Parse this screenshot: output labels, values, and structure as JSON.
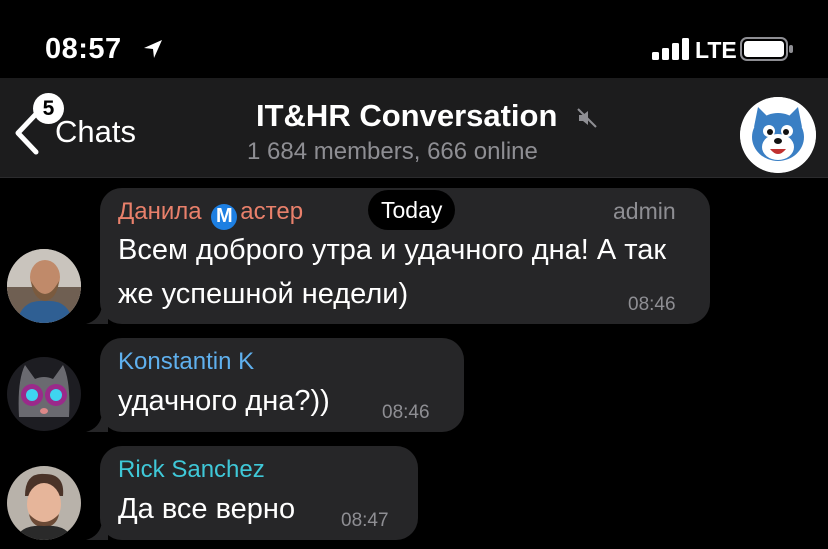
{
  "status_bar": {
    "time": "08:57",
    "network": "LTE"
  },
  "header": {
    "back_badge": "5",
    "back_label": "Chats",
    "title": "IT&HR Conversation",
    "subtitle": "1 684 members, 666 online",
    "icons": {
      "back": "chevron-left-icon",
      "mute": "muted-speaker-icon",
      "location": "location-arrow-icon"
    }
  },
  "date_pill": "Today",
  "messages": [
    {
      "sender_before": "Данила",
      "sender_badge": "M",
      "sender_after": "астер",
      "sender_color": "#e9806b",
      "role": "admin",
      "text": "Всем доброго утра и удачного дна! А так же успешной недели)",
      "time": "08:46"
    },
    {
      "sender": "Konstantin K",
      "sender_color": "#5fb0ee",
      "text": "удачного дна?))",
      "time": "08:46"
    },
    {
      "sender": "Rick Sanchez",
      "sender_color": "#3fc8d8",
      "text": "Да все верно",
      "time": "08:47"
    }
  ],
  "colors": {
    "background": "#000000",
    "header": "#1c1c1d",
    "bubble": "#262628",
    "muted_text": "#8e8e93"
  }
}
